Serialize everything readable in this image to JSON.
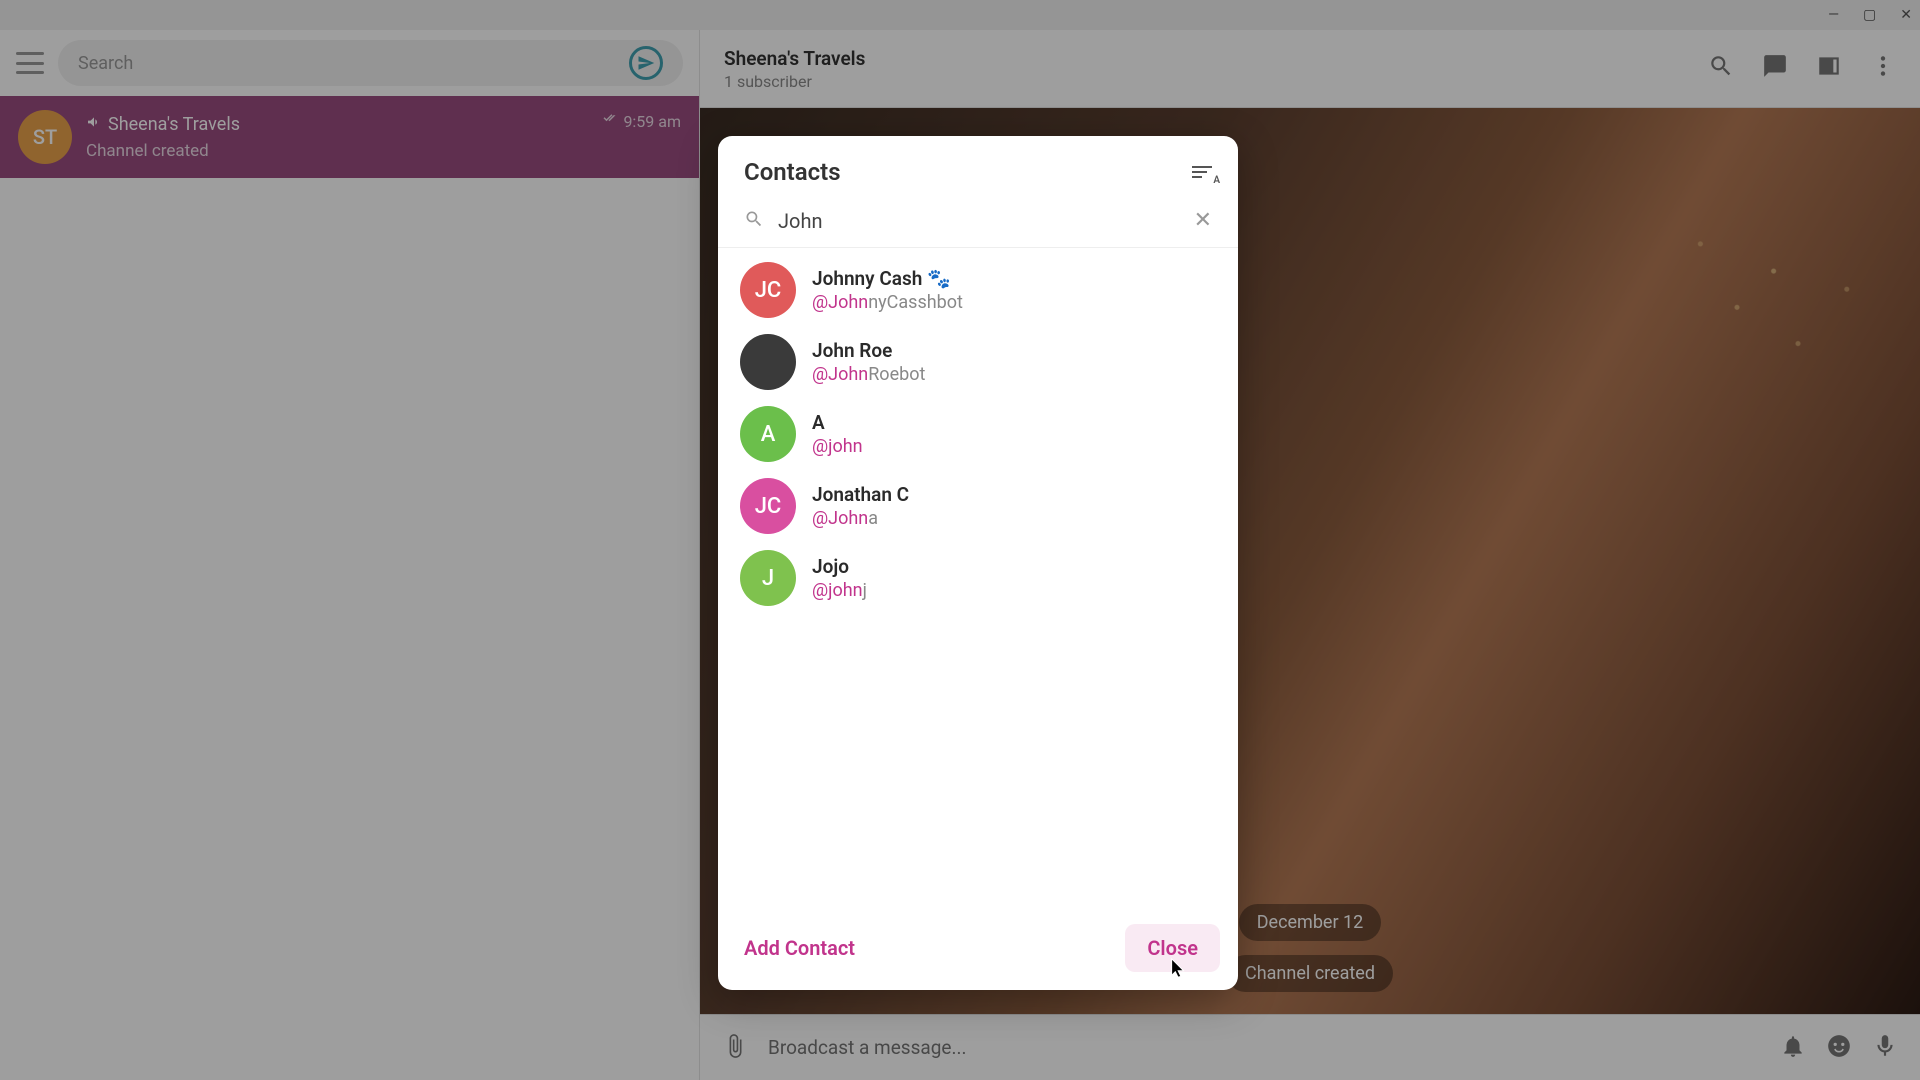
{
  "window_controls": {
    "min": "—",
    "max": "▢",
    "close": "✕"
  },
  "sidebar": {
    "search_placeholder": "Search",
    "chat": {
      "avatar_text": "ST",
      "title": "Sheena's Travels",
      "subtitle": "Channel created",
      "time": "9:59 am"
    }
  },
  "chat_header": {
    "title": "Sheena's Travels",
    "subtitle": "1 subscriber"
  },
  "chat_body": {
    "date": "December 12",
    "system_message": "Channel created"
  },
  "composer": {
    "placeholder": "Broadcast a message..."
  },
  "modal": {
    "title": "Contacts",
    "search_value": "John",
    "add_label": "Add Contact",
    "close_label": "Close",
    "contacts": [
      {
        "avatar_text": "JC",
        "avatar_color": "#e05a5a",
        "name": "Johnny Cash 🐾",
        "handle_match": "@John",
        "handle_rest": "nyCasshbot"
      },
      {
        "avatar_text": "",
        "avatar_color": "#3a3a3a",
        "name": "John Roe",
        "handle_match": "@John",
        "handle_rest": "Roebot"
      },
      {
        "avatar_text": "A",
        "avatar_color": "#6bbf4b",
        "name": "A",
        "handle_match": "@john",
        "handle_rest": ""
      },
      {
        "avatar_text": "JC",
        "avatar_color": "#d94fa0",
        "name": "Jonathan C",
        "handle_match": "@John",
        "handle_rest": "a"
      },
      {
        "avatar_text": "J",
        "avatar_color": "#7fc24e",
        "name": "Jojo",
        "handle_match": "@john",
        "handle_rest": "j"
      }
    ]
  }
}
